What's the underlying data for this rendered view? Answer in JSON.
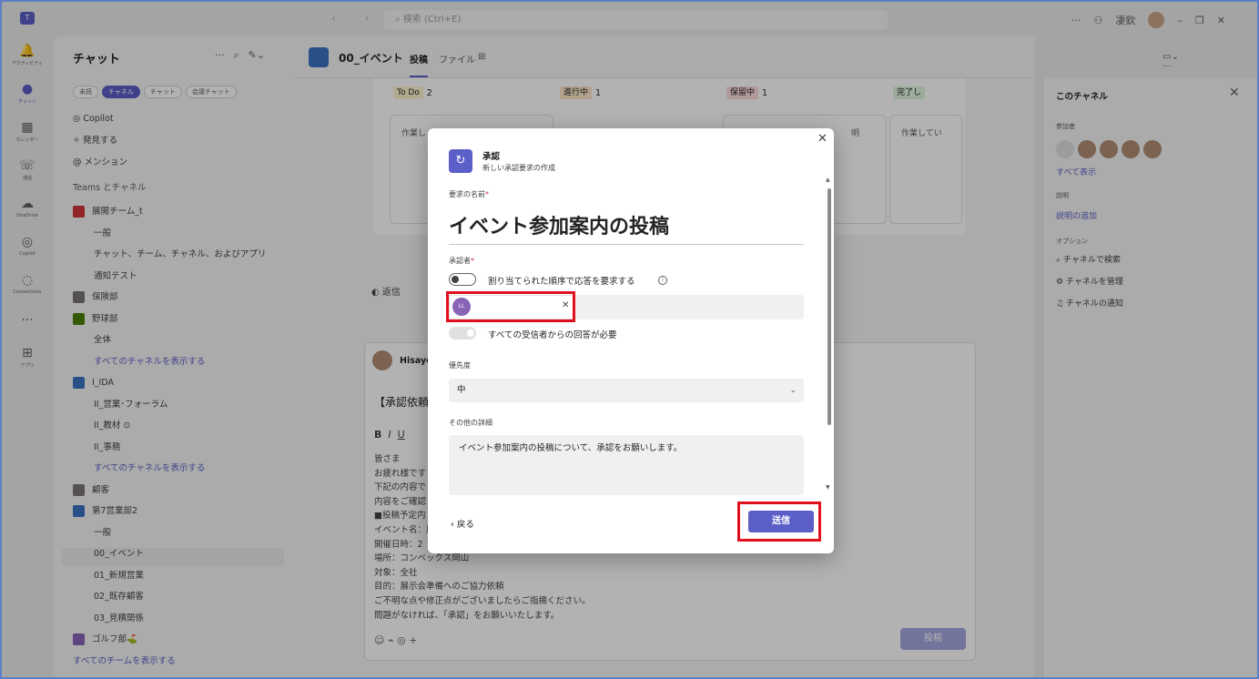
{
  "titlebar": {
    "search_placeholder": "検索 (Ctrl+E)",
    "more": "···",
    "org": "凄欽"
  },
  "rail": [
    {
      "icon": "bell-icon",
      "glyph": "🔔",
      "label": "アクティビティ"
    },
    {
      "icon": "chat-icon",
      "glyph": "●",
      "label": "チャット"
    },
    {
      "icon": "calendar-icon",
      "glyph": "▦",
      "label": "カレンダー"
    },
    {
      "icon": "phone-icon",
      "glyph": "☏",
      "label": "通話"
    },
    {
      "icon": "cloud-icon",
      "glyph": "☁",
      "label": "OneDrive"
    },
    {
      "icon": "copilot-icon",
      "glyph": "◎",
      "label": "Copilot"
    },
    {
      "icon": "connections-icon",
      "glyph": "◌",
      "label": "Connections"
    },
    {
      "icon": "more-icon",
      "glyph": "···",
      "label": ""
    },
    {
      "icon": "apps-icon",
      "glyph": "⊞",
      "label": "アプリ"
    }
  ],
  "sidebar": {
    "title": "チャット",
    "filters": [
      "未読",
      "チャネル",
      "チャット",
      "会議チャット"
    ],
    "top_items": [
      "Copilot",
      "発見する",
      "メンション"
    ],
    "section_label": "Teams とチャネル",
    "rows": [
      {
        "text": "展開チーム_t",
        "type": "team",
        "color": "#d13438"
      },
      {
        "text": "一般",
        "type": "sub"
      },
      {
        "text": "チャット、チーム、チャネル、およびアプリ",
        "type": "sub"
      },
      {
        "text": "通知テスト",
        "type": "sub"
      },
      {
        "text": "保険部",
        "type": "team",
        "color": "#7a7574"
      },
      {
        "text": "野球部",
        "type": "team",
        "color": "#498205"
      },
      {
        "text": "全体",
        "type": "sub"
      },
      {
        "text": "すべてのチャネルを表示する",
        "type": "link"
      },
      {
        "text": "I_IDA",
        "type": "team",
        "color": "#3b72c4"
      },
      {
        "text": "II_営業･フォーラム",
        "type": "sub"
      },
      {
        "text": "II_教材 ⊙",
        "type": "sub"
      },
      {
        "text": "II_事務",
        "type": "sub"
      },
      {
        "text": "すべてのチャネルを表示する",
        "type": "link"
      },
      {
        "text": "顧客",
        "type": "team",
        "color": "#7a7574"
      },
      {
        "text": "第7営業部2",
        "type": "team",
        "color": "#3b72c4"
      },
      {
        "text": "一般",
        "type": "sub"
      },
      {
        "text": "00_イベント",
        "type": "sub"
      },
      {
        "text": "01_新規営業",
        "type": "sub"
      },
      {
        "text": "02_既存顧客",
        "type": "sub"
      },
      {
        "text": "03_見積関係",
        "type": "sub"
      },
      {
        "text": "ゴルフ部⛳",
        "type": "team",
        "color": "#8764b8"
      },
      {
        "text": "すべてのチームを表示する",
        "type": "toplink"
      }
    ]
  },
  "channel": {
    "name": "00_イベント",
    "tabs": [
      "投稿",
      "ファイル",
      "⊞"
    ]
  },
  "board": {
    "columns": [
      {
        "label": "To Do",
        "count": "2",
        "color": "#fff4ce"
      },
      {
        "label": "進行中",
        "count": "1",
        "color": "#fde7c7"
      },
      {
        "label": "保留中",
        "count": "1",
        "color": "#fcdcdc"
      },
      {
        "label": "完了し",
        "count": "",
        "color": "#dff6dd"
      }
    ],
    "card_texts": [
      "作業し",
      "",
      "明",
      "作業してい"
    ]
  },
  "post": {
    "reply": "返信",
    "author": "Hisayo",
    "subject": "【承認依頼",
    "body_lines": [
      "皆さま",
      "お疲れ様です",
      "下記の内容で",
      "内容をご確認",
      "■投稿予定内",
      "イベント名：展",
      "開催日時：2",
      "場所：コンベックス岡山",
      "対象：全社",
      "目的：展示会準備へのご協力依頼",
      "ご不明な点や修正点がございましたらご指摘ください。",
      "問題がなければ、「承認」をお願いいたします。"
    ],
    "post_button": "投稿"
  },
  "right_panel": {
    "title": "このチャネル",
    "members_label": "参加者",
    "show_all": "すべて表示",
    "desc_label": "説明",
    "desc_link": "説明の追加",
    "options_label": "オプション",
    "options": [
      "チャネルで検索",
      "チャネルを管理",
      "チャネルの通知"
    ]
  },
  "dialog": {
    "app_title": "承認",
    "app_subtitle": "新しい承認要求の作成",
    "name_label": "要求の名前",
    "name_value": "イベント参加案内の投稿",
    "approver_label": "承認者",
    "sequential_toggle_label": "割り当てられた順序で応答を要求する",
    "approver_initials": "LL",
    "all_response_label": "すべての受信者からの回答が必要",
    "priority_label": "優先度",
    "priority_value": "中",
    "details_label": "その他の詳細",
    "details_value": "イベント参加案内の投稿について、承認をお願いします。",
    "back_label": "戻る",
    "send_label": "送信",
    "required_mark": "*"
  },
  "colors": {
    "brand": "#5b5fc7",
    "highlight": "#e0101f"
  }
}
